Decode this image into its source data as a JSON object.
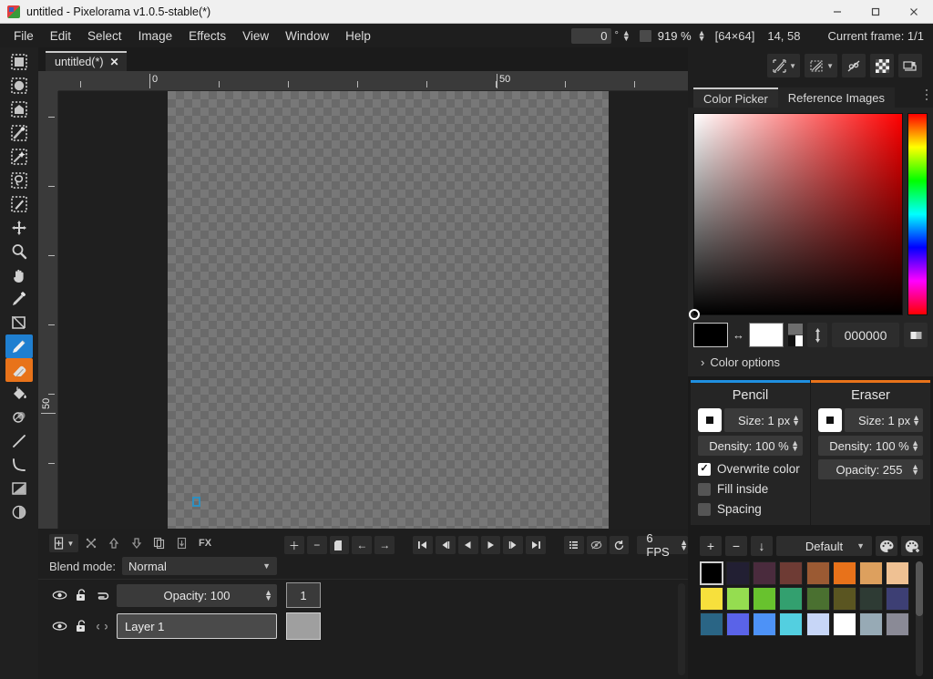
{
  "window": {
    "title": "untitled - Pixelorama v1.0.5-stable(*)",
    "minimize_label": "–",
    "maximize_label": "□",
    "close_label": "✕"
  },
  "menubar": {
    "items": [
      {
        "label": "File"
      },
      {
        "label": "Edit"
      },
      {
        "label": "Select"
      },
      {
        "label": "Image"
      },
      {
        "label": "Effects"
      },
      {
        "label": "View"
      },
      {
        "label": "Window"
      },
      {
        "label": "Help"
      }
    ],
    "rotation_value": "0",
    "rotation_unit": "°",
    "zoom_value": "919 %",
    "canvas_size": "[64×64]",
    "cursor_coords": "14, 58",
    "current_frame": "Current frame: 1/1"
  },
  "tools": [
    {
      "name": "rectangle-select-tool",
      "selected": false
    },
    {
      "name": "ellipse-select-tool",
      "selected": false
    },
    {
      "name": "polygon-select-tool",
      "selected": false
    },
    {
      "name": "magic-wand-tool",
      "selected": false
    },
    {
      "name": "select-by-color-tool",
      "selected": false
    },
    {
      "name": "lasso-select-tool",
      "selected": false
    },
    {
      "name": "magic-pencil-select-tool",
      "selected": false
    },
    {
      "name": "move-tool",
      "selected": false
    },
    {
      "name": "zoom-tool",
      "selected": false
    },
    {
      "name": "pan-tool",
      "selected": false
    },
    {
      "name": "color-picker-tool",
      "selected": false
    },
    {
      "name": "crop-tool",
      "selected": false
    },
    {
      "name": "pencil-tool",
      "selected": true,
      "accent": "#1f7fd0"
    },
    {
      "name": "eraser-tool",
      "selected": true,
      "accent": "#e8731a"
    },
    {
      "name": "bucket-fill-tool",
      "selected": false
    },
    {
      "name": "shading-tool",
      "selected": false
    },
    {
      "name": "line-tool",
      "selected": false
    },
    {
      "name": "curve-tool",
      "selected": false
    },
    {
      "name": "rectangle-shape-tool",
      "selected": false
    },
    {
      "name": "ellipse-shape-tool",
      "selected": false
    }
  ],
  "canvas": {
    "tab_label": "untitled(*)",
    "tab_close": "✕",
    "ruler_h_labels": [
      {
        "text": "0",
        "pos": 122
      },
      {
        "text": "50",
        "pos": 503
      }
    ],
    "ruler_v_labels": [
      {
        "text": "50",
        "pos": 353
      }
    ]
  },
  "timeline": {
    "layer_buttons": [
      "add-layer",
      "layer-menu-chevron",
      "delete-layer",
      "move-layer-up",
      "move-layer-down",
      "clone-layer",
      "merge-layer-down",
      "layer-effects"
    ],
    "layer_fx_label": "FX",
    "blend_mode_label": "Blend mode:",
    "blend_mode_value": "Normal",
    "animation_buttons": [
      "add-frame",
      "remove-frame",
      "copy-frame",
      "move-frame-left",
      "move-frame-right",
      "go-to-first-frame",
      "step-back-frame",
      "play-backwards",
      "play-forwards",
      "step-forward-frame",
      "go-to-last-frame",
      "frame-tag-list",
      "onion-skinning",
      "loop-animation"
    ],
    "fps_label": "6 FPS",
    "opacity_label": "Opacity: 100",
    "frame_number": "1",
    "layer_name": "Layer 1"
  },
  "right_panel": {
    "toolbar_buttons": [
      {
        "name": "layer-transform-dropdown"
      },
      {
        "name": "selection-transform-dropdown"
      },
      {
        "name": "snap-toggle"
      },
      {
        "name": "transparency-toggle"
      },
      {
        "name": "canvas-preview-toggle"
      }
    ],
    "tabs": [
      {
        "label": "Color Picker",
        "active": true
      },
      {
        "label": "Reference Images",
        "active": false
      }
    ],
    "color_picker": {
      "primary_color": "#000000",
      "secondary_color": "#ffffff",
      "hex_value": "000000",
      "swap_icon": "↔",
      "color_options_label": "Color options",
      "color_options_chevron": "›"
    },
    "tool_options": {
      "left": {
        "title": "Pencil",
        "accent": "#1f8fe0",
        "size_label": "Size: 1 px",
        "density_label": "Density: 100 %",
        "checkboxes": [
          {
            "label": "Overwrite color",
            "checked": true
          },
          {
            "label": "Fill inside",
            "checked": false
          },
          {
            "label": "Spacing",
            "checked": false
          }
        ]
      },
      "right": {
        "title": "Eraser",
        "accent": "#e8731a",
        "size_label": "Size: 1 px",
        "density_label": "Density: 100 %",
        "opacity_label": "Opacity: 255"
      }
    },
    "palette": {
      "add_label": "+",
      "remove_label": "−",
      "sort_label": "↓",
      "selected_palette": "Default",
      "chevron": "⌄",
      "edit_palette_name": "edit-palette-icon",
      "new_palette_name": "new-palette-icon",
      "colors": [
        "#000000",
        "#221f33",
        "#4a2b3d",
        "#6e3b34",
        "#9b5a33",
        "#e8721a",
        "#dda05e",
        "#efc193",
        "#f7e03c",
        "#95dd50",
        "#68c22e",
        "#33a06f",
        "#4a7030",
        "#5a5521",
        "#2e3b34",
        "#3d3f74",
        "#2a6585",
        "#5a63e8",
        "#4d92f7",
        "#53cfe0",
        "#c7d6f7",
        "#ffffff",
        "#97aab5",
        "#8a8a96"
      ],
      "selected_index": 0
    }
  }
}
